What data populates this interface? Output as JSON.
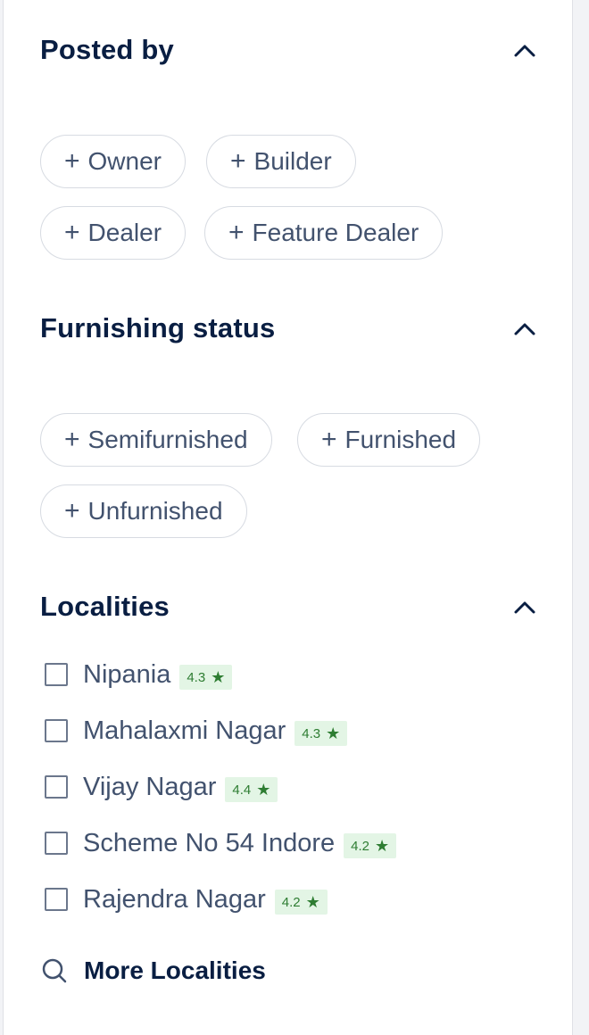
{
  "posted_by": {
    "title": "Posted by",
    "chips": [
      "Owner",
      "Builder",
      "Dealer",
      "Feature Dealer"
    ]
  },
  "furnishing": {
    "title": "Furnishing status",
    "chips": [
      "Semifurnished",
      "Furnished",
      "Unfurnished"
    ]
  },
  "localities": {
    "title": "Localities",
    "items": [
      {
        "name": "Nipania",
        "rating": "4.3"
      },
      {
        "name": "Mahalaxmi Nagar",
        "rating": "4.3"
      },
      {
        "name": "Vijay Nagar",
        "rating": "4.4"
      },
      {
        "name": "Scheme No 54 Indore",
        "rating": "4.2"
      },
      {
        "name": "Rajendra Nagar",
        "rating": "4.2"
      }
    ],
    "more_label": "More Localities"
  },
  "icons": {
    "chip_plus": "+",
    "star": "★",
    "collapse": "chevron-up-icon",
    "search": "search-icon"
  },
  "colors": {
    "title": "#091e42",
    "chip_border": "#d7dbe2",
    "rating_bg": "#e3f5e5",
    "rating_text": "#2e7d32"
  }
}
